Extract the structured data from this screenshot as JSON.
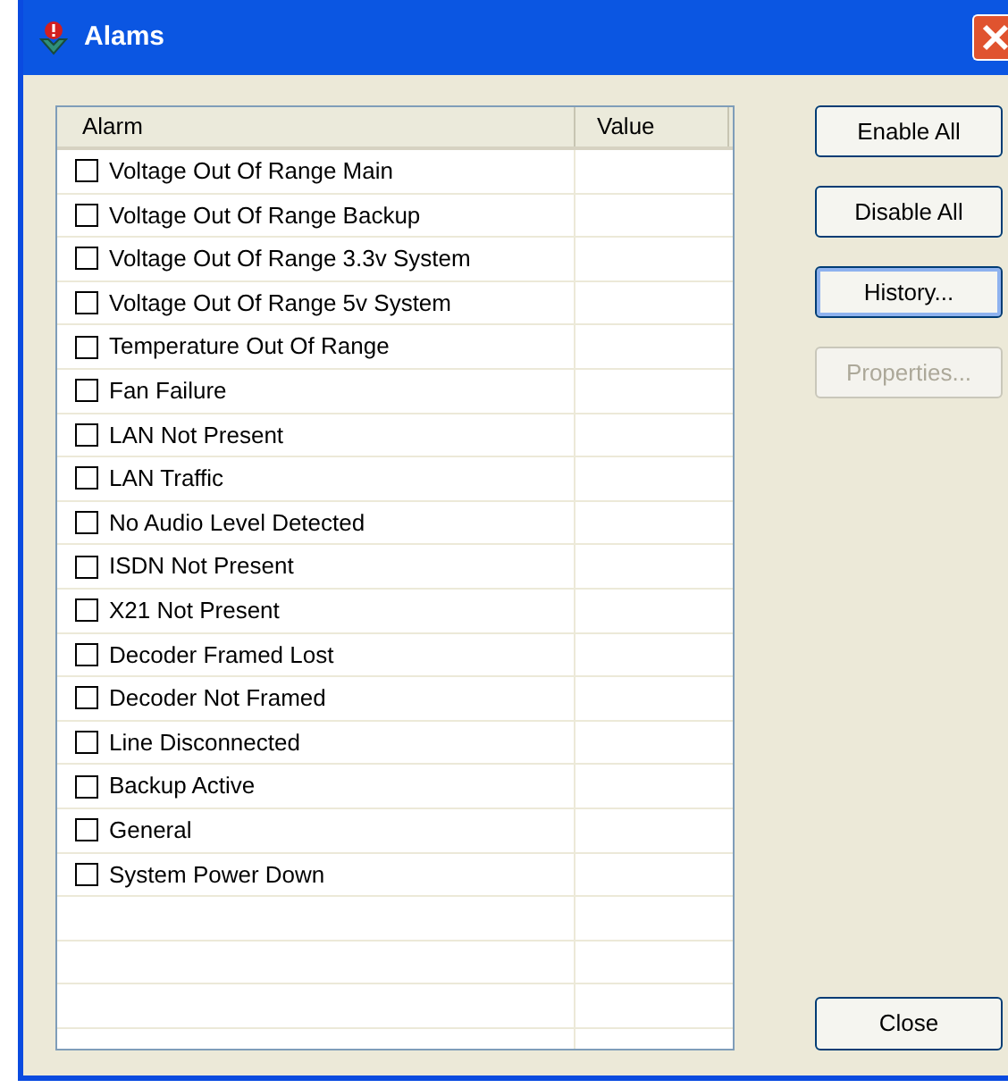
{
  "window": {
    "title": "Alams"
  },
  "table": {
    "columns": [
      "Alarm",
      "Value"
    ],
    "rows": [
      {
        "label": "Voltage Out Of Range Main",
        "checked": false
      },
      {
        "label": "Voltage Out Of Range Backup",
        "checked": false
      },
      {
        "label": "Voltage Out Of Range 3.3v System",
        "checked": false
      },
      {
        "label": "Voltage Out Of Range 5v System",
        "checked": false
      },
      {
        "label": "Temperature Out Of Range",
        "checked": false
      },
      {
        "label": "Fan Failure",
        "checked": false
      },
      {
        "label": "LAN Not Present",
        "checked": false
      },
      {
        "label": "LAN Traffic",
        "checked": false
      },
      {
        "label": "No Audio Level Detected",
        "checked": false
      },
      {
        "label": "ISDN Not Present",
        "checked": false
      },
      {
        "label": "X21 Not Present",
        "checked": false
      },
      {
        "label": "Decoder Framed Lost",
        "checked": false
      },
      {
        "label": "Decoder Not Framed",
        "checked": false
      },
      {
        "label": "Line Disconnected",
        "checked": false
      },
      {
        "label": "Backup Active",
        "checked": false
      },
      {
        "label": "General",
        "checked": false
      },
      {
        "label": "System Power Down",
        "checked": false
      }
    ]
  },
  "buttons": [
    {
      "label": "Enable All",
      "disabled": false,
      "focused": false
    },
    {
      "label": "Disable All",
      "disabled": false,
      "focused": false
    },
    {
      "label": "History...",
      "disabled": false,
      "focused": true
    },
    {
      "label": "Properties...",
      "disabled": true,
      "focused": false
    }
  ],
  "close_button": {
    "label": "Close"
  }
}
